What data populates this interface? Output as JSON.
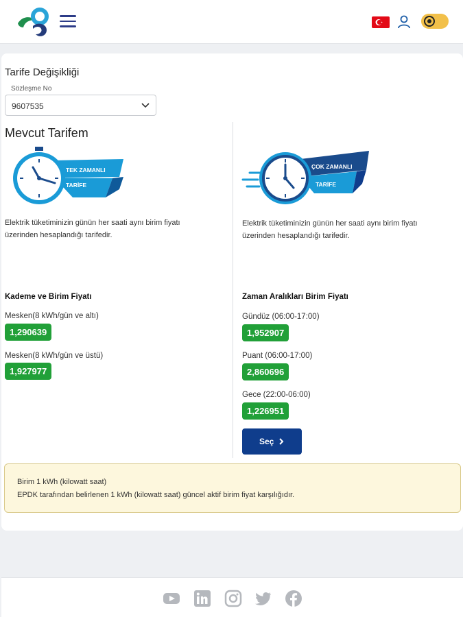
{
  "header": {
    "logo_icon": "company-logo",
    "menu_icon": "hamburger-icon",
    "flag_icon": "turkish-flag-icon",
    "user_icon": "user-icon",
    "theme_icon": "sun-toggle-icon"
  },
  "page": {
    "title": "Tarife Değişikliği",
    "contract_label": "Sözleşme No",
    "contract_value": "9607535",
    "current_tariff_title": "Mevcut Tarifem"
  },
  "left": {
    "illustration_line1": "TEK ZAMANLI",
    "illustration_line2": "TARİFE",
    "description_line1": "Elektrik tüketiminizin günün her saati aynı birim fiyatı",
    "description_line2": "üzerinden hesaplandığı tarifedir.",
    "section_title": "Kademe ve Birim Fiyatı",
    "prices": [
      {
        "label": "Mesken(8 kWh/gün ve altı)",
        "value": "1,290639"
      },
      {
        "label": "Mesken(8 kWh/gün ve üstü)",
        "value": "1,927977"
      }
    ]
  },
  "right": {
    "illustration_line1": "ÇOK ZAMANLI",
    "illustration_line2": "TARİFE",
    "description_line1": "Elektrik tüketiminizin günün her saati aynı birim fiyatı",
    "description_line2": "üzerinden hesaplandığı tarifedir.",
    "section_title": "Zaman Aralıkları Birim Fiyatı",
    "prices": [
      {
        "label": "Gündüz (06:00-17:00)",
        "value": "1,952907"
      },
      {
        "label": "Puant (06:00-17:00)",
        "value": "2,860696"
      },
      {
        "label": "Gece (22:00-06:00)",
        "value": "1,226951"
      }
    ],
    "select_button": "Seç"
  },
  "note": {
    "line1": "Birim 1 kWh (kilowatt saat)",
    "line2": "EPDK tarafından belirlenen 1 kWh (kilowatt saat) güncel aktif birim fiyat karşılığıdır."
  },
  "footer": {
    "social_icons": [
      "youtube-icon",
      "linkedin-icon",
      "instagram-icon",
      "twitter-icon",
      "facebook-icon"
    ]
  },
  "colors": {
    "primary": "#0f3d8c",
    "badge_green": "#21a038",
    "note_bg": "#fdf7dd",
    "illustration_blue": "#1a9bd7"
  }
}
